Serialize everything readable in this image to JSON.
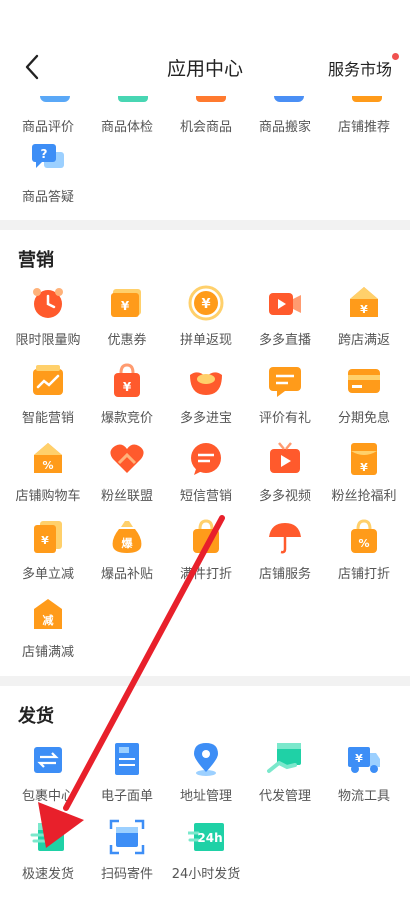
{
  "header": {
    "title": "应用中心",
    "market_label": "服务市场"
  },
  "sections": {
    "top": {
      "items": [
        {
          "label": "商品评价",
          "icon": "review-icon"
        },
        {
          "label": "商品体检",
          "icon": "checkup-icon"
        },
        {
          "label": "机会商品",
          "icon": "opportunity-icon"
        },
        {
          "label": "商品搬家",
          "icon": "move-icon"
        },
        {
          "label": "店铺推荐",
          "icon": "recommend-icon"
        },
        {
          "label": "商品答疑",
          "icon": "qa-icon"
        }
      ]
    },
    "marketing": {
      "title": "营销",
      "items": [
        {
          "label": "限时限量购",
          "icon": "alarm-clock-icon"
        },
        {
          "label": "优惠券",
          "icon": "coupon-icon"
        },
        {
          "label": "拼单返现",
          "icon": "cashback-icon"
        },
        {
          "label": "多多直播",
          "icon": "live-icon"
        },
        {
          "label": "跨店满返",
          "icon": "cross-store-icon"
        },
        {
          "label": "智能营销",
          "icon": "smart-marketing-icon"
        },
        {
          "label": "爆款竞价",
          "icon": "bidding-icon"
        },
        {
          "label": "多多进宝",
          "icon": "treasure-icon"
        },
        {
          "label": "评价有礼",
          "icon": "review-gift-icon"
        },
        {
          "label": "分期免息",
          "icon": "installment-icon"
        },
        {
          "label": "店铺购物车",
          "icon": "store-cart-icon"
        },
        {
          "label": "粉丝联盟",
          "icon": "fan-heart-icon"
        },
        {
          "label": "短信营销",
          "icon": "sms-icon"
        },
        {
          "label": "多多视频",
          "icon": "video-icon"
        },
        {
          "label": "粉丝抢福利",
          "icon": "fan-welfare-icon"
        },
        {
          "label": "多单立减",
          "icon": "multi-discount-icon"
        },
        {
          "label": "爆品补贴",
          "icon": "subsidy-bag-icon"
        },
        {
          "label": "满件打折",
          "icon": "bulk-discount-icon"
        },
        {
          "label": "店铺服务",
          "icon": "umbrella-icon"
        },
        {
          "label": "店铺打折",
          "icon": "store-discount-icon"
        },
        {
          "label": "店铺满减",
          "icon": "store-reduce-icon"
        }
      ]
    },
    "shipping": {
      "title": "发货",
      "items": [
        {
          "label": "包裹中心",
          "icon": "package-center-icon"
        },
        {
          "label": "电子面单",
          "icon": "waybill-icon"
        },
        {
          "label": "地址管理",
          "icon": "location-pin-icon"
        },
        {
          "label": "代发管理",
          "icon": "dropship-icon"
        },
        {
          "label": "物流工具",
          "icon": "truck-icon"
        },
        {
          "label": "极速发货",
          "icon": "fast-ship-icon"
        },
        {
          "label": "扫码寄件",
          "icon": "scan-icon"
        },
        {
          "label": "24小时发货",
          "icon": "24h-icon"
        }
      ]
    }
  },
  "colors": {
    "orange": "#ff9b1a",
    "red_orange": "#ff5a2c",
    "blue": "#3d8ef6",
    "green": "#1fd1a6",
    "arrow": "#e8202b",
    "separator": "#f2f2f2"
  }
}
